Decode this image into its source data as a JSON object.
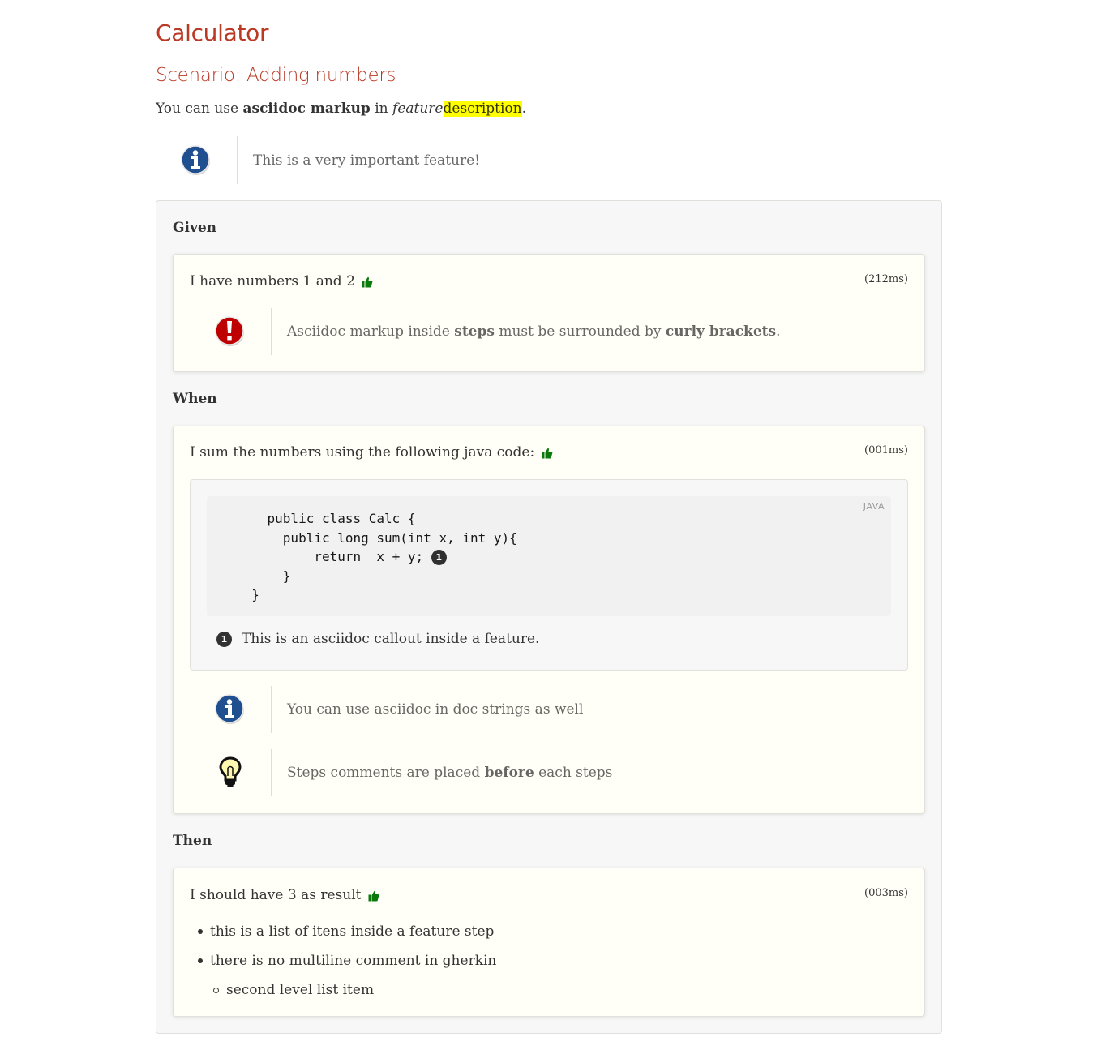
{
  "feature": {
    "title": "Calculator",
    "scenario_title": "Scenario: Adding numbers",
    "description": {
      "part1": "You can use ",
      "bold": "asciidoc markup",
      "part2": " in ",
      "italic": "feature",
      "highlight": "description",
      "part3": "."
    },
    "note": {
      "icon": "info-icon",
      "text": "This is a very important feature!"
    }
  },
  "steps": {
    "given": {
      "keyword": "Given",
      "text": "I have numbers 1 and 2",
      "status_icon": "thumbs-up-icon",
      "duration": "(212ms)",
      "admonition": {
        "icon": "warning-icon",
        "text1": "Asciidoc markup inside ",
        "bold1": "steps",
        "text2": " must be surrounded by ",
        "bold2": "curly brackets",
        "text3": "."
      }
    },
    "when": {
      "keyword": "When",
      "text": "I sum the numbers using the following java code:",
      "status_icon": "thumbs-up-icon",
      "duration": "(001ms)",
      "code_language": "JAVA",
      "code_lines": [
        "    public class Calc {",
        "      public long sum(int x, int y){",
        "          return  x + y; ",
        "      }",
        "  }"
      ],
      "callout_number": "1",
      "callout_text": "This is an asciidoc callout inside a feature.",
      "note": {
        "icon": "info-icon",
        "text": "You can use asciidoc in doc strings as well"
      },
      "tip": {
        "icon": "lightbulb-icon",
        "text1": "Steps comments are placed ",
        "bold": "before",
        "text2": " each steps"
      }
    },
    "then": {
      "keyword": "Then",
      "text": "I should have 3 as result",
      "status_icon": "thumbs-up-icon",
      "duration": "(003ms)",
      "list": [
        "this is a list of itens inside a feature step",
        "there is no multiline comment in gherkin"
      ],
      "sublist": [
        "second level list item"
      ]
    }
  },
  "colors": {
    "heading": "#ba3925",
    "highlight": "#ffff00",
    "success": "#0b7a0b",
    "info_icon": "#1f4f8f",
    "warning_icon": "#bf0000"
  }
}
